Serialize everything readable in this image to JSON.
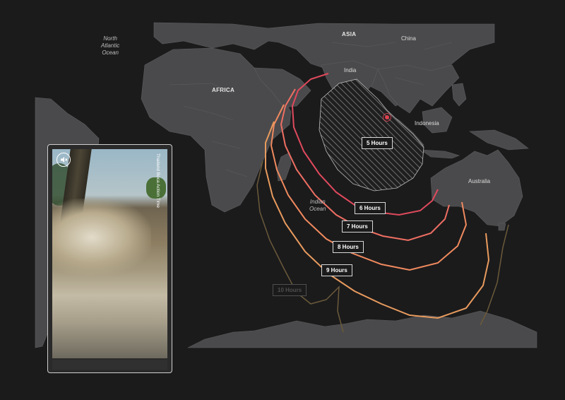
{
  "map": {
    "regions": {
      "asia": "ASIA",
      "africa": "AFRICA"
    },
    "oceans": {
      "north_atlantic": [
        "North",
        "Atlantic",
        "Ocean"
      ],
      "indian": [
        "Indian",
        "Ocean"
      ]
    },
    "places": {
      "china": "China",
      "india": "India",
      "indonesia": "Indonesia",
      "australia": "Australia"
    },
    "epicenter_icon": "epicenter-star-icon",
    "colors": {
      "background": "#1b1b1c",
      "land": "#4a4a4c",
      "five_hour_zone_hatch": "#9a9a9a"
    }
  },
  "travel_times": [
    {
      "label": "5 Hours",
      "color": "#ffffff"
    },
    {
      "label": "6 Hours",
      "color": "#e04a5c"
    },
    {
      "label": "7 Hours",
      "color": "#ef6f62"
    },
    {
      "label": "8 Hours",
      "color": "#f08a5e"
    },
    {
      "label": "9 Hours",
      "color": "#e89b5e"
    },
    {
      "label": "10 Hours",
      "color": "#6b5a3a"
    }
  ],
  "video": {
    "credit": "Thailand Boca Action Time",
    "mute_icon": "speaker-mute-icon"
  }
}
